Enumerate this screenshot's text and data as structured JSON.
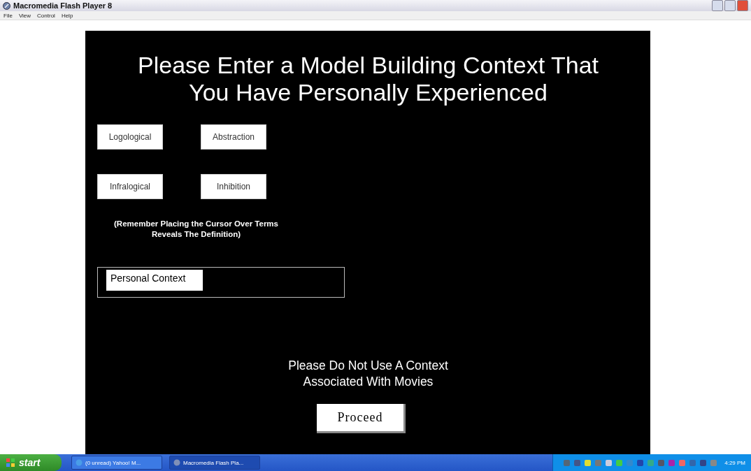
{
  "window": {
    "title": "Macromedia Flash Player 8"
  },
  "menu": [
    "File",
    "View",
    "Control",
    "Help"
  ],
  "stage": {
    "heading": "Please Enter a Model Building Context That You Have Personally Experienced",
    "terms": [
      {
        "label": "Logological"
      },
      {
        "label": "Abstraction"
      },
      {
        "label": "Infralogical"
      },
      {
        "label": "Inhibition"
      }
    ],
    "hint": "(Remember Placing the Cursor Over Terms Reveals The Definition)",
    "context_field": {
      "label": "Personal Context"
    },
    "notice": "Please Do Not Use A Context Associated With Movies",
    "proceed_button": "Proceed"
  },
  "taskbar": {
    "start": "start",
    "tasks": [
      {
        "label": "(0 unread) Yahoo! M...",
        "selected": false
      },
      {
        "label": "Macromedia Flash Pla...",
        "selected": true
      }
    ],
    "clock": "4:29 PM"
  }
}
